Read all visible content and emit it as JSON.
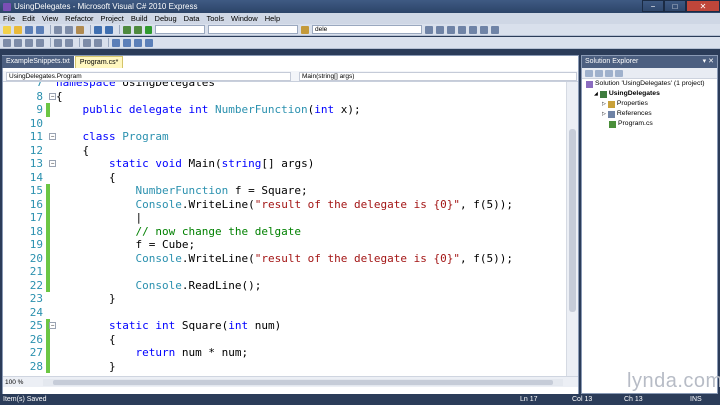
{
  "window": {
    "title": "UsingDelegates - Microsoft Visual C# 2010 Express",
    "min": "−",
    "max": "□",
    "close": "✕"
  },
  "menu": [
    "File",
    "Edit",
    "View",
    "Refactor",
    "Project",
    "Build",
    "Debug",
    "Data",
    "Tools",
    "Window",
    "Help"
  ],
  "toolbar": {
    "find_value": "dele"
  },
  "tabs": [
    {
      "label": "ExampleSnippets.txt"
    },
    {
      "label": "Program.cs*"
    }
  ],
  "nav": {
    "class_combo": "UsingDelegates.Program",
    "member_combo": "Main(string[] args)"
  },
  "editor": {
    "zoom": "100 %",
    "lines": [
      {
        "num": "7",
        "segments": [
          {
            "t": "namespace ",
            "c": "kw"
          },
          {
            "t": "UsingDelegates",
            "c": ""
          }
        ]
      },
      {
        "num": "8",
        "segments": [
          {
            "t": "{",
            "c": ""
          }
        ]
      },
      {
        "num": "9",
        "segments": [
          {
            "t": "    ",
            "c": ""
          },
          {
            "t": "public delegate int ",
            "c": "kw"
          },
          {
            "t": "NumberFunction",
            "c": "ty"
          },
          {
            "t": "(",
            "c": ""
          },
          {
            "t": "int ",
            "c": "kw"
          },
          {
            "t": "x);",
            "c": ""
          }
        ]
      },
      {
        "num": "10",
        "segments": [
          {
            "t": "",
            "c": ""
          }
        ]
      },
      {
        "num": "11",
        "segments": [
          {
            "t": "    ",
            "c": ""
          },
          {
            "t": "class ",
            "c": "kw"
          },
          {
            "t": "Program",
            "c": "ty"
          }
        ]
      },
      {
        "num": "12",
        "segments": [
          {
            "t": "    {",
            "c": ""
          }
        ]
      },
      {
        "num": "13",
        "segments": [
          {
            "t": "        ",
            "c": ""
          },
          {
            "t": "static void ",
            "c": "kw"
          },
          {
            "t": "Main(",
            "c": ""
          },
          {
            "t": "string",
            "c": "kw"
          },
          {
            "t": "[] args)",
            "c": ""
          }
        ]
      },
      {
        "num": "14",
        "segments": [
          {
            "t": "        {",
            "c": ""
          }
        ]
      },
      {
        "num": "15",
        "segments": [
          {
            "t": "            ",
            "c": ""
          },
          {
            "t": "NumberFunction",
            "c": "ty"
          },
          {
            "t": " f = Square;",
            "c": ""
          }
        ]
      },
      {
        "num": "16",
        "segments": [
          {
            "t": "            ",
            "c": ""
          },
          {
            "t": "Console",
            "c": "ty"
          },
          {
            "t": ".WriteLine(",
            "c": ""
          },
          {
            "t": "\"result of the delegate is {0}\"",
            "c": "str"
          },
          {
            "t": ", f(5));",
            "c": ""
          }
        ]
      },
      {
        "num": "17",
        "segments": [
          {
            "t": "            |",
            "c": ""
          }
        ]
      },
      {
        "num": "18",
        "segments": [
          {
            "t": "            ",
            "c": ""
          },
          {
            "t": "// now change the delgate",
            "c": "cm"
          }
        ]
      },
      {
        "num": "19",
        "segments": [
          {
            "t": "            f = Cube;",
            "c": ""
          }
        ]
      },
      {
        "num": "20",
        "segments": [
          {
            "t": "            ",
            "c": ""
          },
          {
            "t": "Console",
            "c": "ty"
          },
          {
            "t": ".WriteLine(",
            "c": ""
          },
          {
            "t": "\"result of the delegate is {0}\"",
            "c": "str"
          },
          {
            "t": ", f(5));",
            "c": ""
          }
        ]
      },
      {
        "num": "21",
        "segments": [
          {
            "t": "",
            "c": ""
          }
        ]
      },
      {
        "num": "22",
        "segments": [
          {
            "t": "            ",
            "c": ""
          },
          {
            "t": "Console",
            "c": "ty"
          },
          {
            "t": ".ReadLine();",
            "c": ""
          }
        ]
      },
      {
        "num": "23",
        "segments": [
          {
            "t": "        }",
            "c": ""
          }
        ]
      },
      {
        "num": "24",
        "segments": [
          {
            "t": "",
            "c": ""
          }
        ]
      },
      {
        "num": "25",
        "segments": [
          {
            "t": "        ",
            "c": ""
          },
          {
            "t": "static int ",
            "c": "kw"
          },
          {
            "t": "Square(",
            "c": ""
          },
          {
            "t": "int ",
            "c": "kw"
          },
          {
            "t": "num)",
            "c": ""
          }
        ]
      },
      {
        "num": "26",
        "segments": [
          {
            "t": "        {",
            "c": ""
          }
        ]
      },
      {
        "num": "27",
        "segments": [
          {
            "t": "            ",
            "c": ""
          },
          {
            "t": "return ",
            "c": "kw"
          },
          {
            "t": "num * num;",
            "c": ""
          }
        ]
      },
      {
        "num": "28",
        "segments": [
          {
            "t": "        }",
            "c": ""
          }
        ]
      }
    ]
  },
  "solution_explorer": {
    "title": "Solution Explorer",
    "items": [
      {
        "label": "Solution 'UsingDelegates' (1 project)",
        "indent": 0,
        "icon": "solution-icon"
      },
      {
        "label": "UsingDelegates",
        "indent": 1,
        "icon": "project-icon",
        "bold": true
      },
      {
        "label": "Properties",
        "indent": 2,
        "icon": "properties-icon"
      },
      {
        "label": "References",
        "indent": 2,
        "icon": "references-icon"
      },
      {
        "label": "Program.cs",
        "indent": 2,
        "icon": "csharp-file-icon"
      }
    ]
  },
  "status": {
    "left": "Item(s) Saved",
    "ln": "Ln 17",
    "col": "Col 13",
    "ch": "Ch 13",
    "mode": "INS"
  },
  "watermark": "lynda.com",
  "colors": {
    "keyword": "#0000ff",
    "type": "#2b91af",
    "string": "#a31515",
    "comment": "#008000",
    "change_bar": "#6cc644"
  }
}
